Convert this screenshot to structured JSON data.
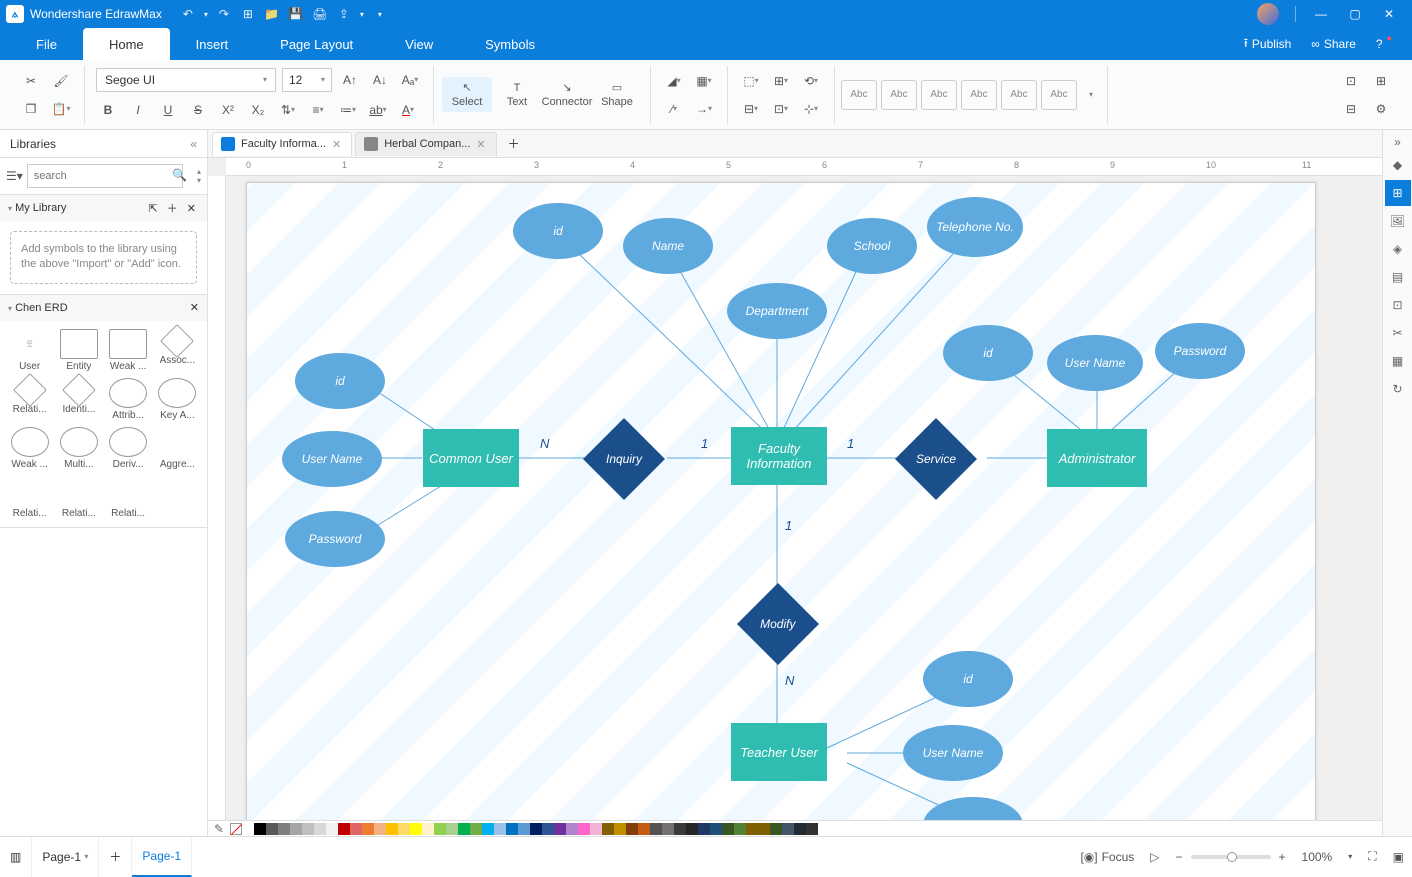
{
  "app": {
    "name": "Wondershare EdrawMax"
  },
  "qat": [
    "undo",
    "redo",
    "new",
    "open",
    "save",
    "print",
    "export",
    "more"
  ],
  "menu": {
    "items": [
      "File",
      "Home",
      "Insert",
      "Page Layout",
      "View",
      "Symbols"
    ],
    "active": 1,
    "publish": "Publish",
    "share": "Share"
  },
  "ribbon": {
    "font": {
      "name": "Segoe UI",
      "size": "12"
    },
    "tools": {
      "select": "Select",
      "text": "Text",
      "connector": "Connector",
      "shape": "Shape"
    },
    "styles": [
      "Abc",
      "Abc",
      "Abc",
      "Abc",
      "Abc",
      "Abc"
    ]
  },
  "leftpanel": {
    "title": "Libraries",
    "search_placeholder": "search",
    "mylib": {
      "title": "My Library",
      "hint": "Add symbols to the library using the above \"Import\" or \"Add\" icon."
    },
    "chen": {
      "title": "Chen ERD",
      "shapes": [
        "User",
        "Entity",
        "Weak ...",
        "Assoc...",
        "Relati...",
        "Identi...",
        "Attrib...",
        "Key A...",
        "Weak ...",
        "Multi...",
        "Deriv...",
        "Aggre...",
        "Relati...",
        "Relati...",
        "Relati..."
      ]
    }
  },
  "doctabs": [
    {
      "label": "Faculty Informa...",
      "active": true
    },
    {
      "label": "Herbal Compan...",
      "active": false
    }
  ],
  "ruler": [
    "0",
    "1",
    "2",
    "3",
    "4",
    "5",
    "6",
    "7",
    "8",
    "9",
    "10",
    "11"
  ],
  "diagram": {
    "entities": {
      "common_user": "Common User",
      "faculty_info": "Faculty Information",
      "administrator": "Administrator",
      "teacher_user": "Teacher User"
    },
    "attrs": {
      "cu_id": "id",
      "cu_username": "User Name",
      "cu_password": "Password",
      "fi_id": "id",
      "fi_name": "Name",
      "fi_dept": "Department",
      "fi_school": "School",
      "fi_tel": "Telephone No.",
      "ad_id": "id",
      "ad_username": "User Name",
      "ad_password": "Password",
      "tu_id": "id",
      "tu_username": "User Name"
    },
    "rels": {
      "inquiry": "Inquiry",
      "service": "Service",
      "modify": "Modify"
    },
    "card": {
      "nq_n": "N",
      "nq_1": "1",
      "sv_1l": "1",
      "sv_1r": "",
      "mod_1": "1",
      "mod_n": "N"
    }
  },
  "status": {
    "page_sheet": "Page-1",
    "page_tab": "Page-1",
    "focus": "Focus",
    "zoom": "100%"
  },
  "colorrow": [
    "#ffffff",
    "#000000",
    "#595959",
    "#7f7f7f",
    "#a5a5a5",
    "#bfbfbf",
    "#d8d8d8",
    "#f2f2f2",
    "#c00000",
    "#e06666",
    "#ed7d31",
    "#f4b183",
    "#ffc000",
    "#ffd966",
    "#ffff00",
    "#fff2cc",
    "#92d050",
    "#a9d08e",
    "#00b050",
    "#70ad47",
    "#00b0f0",
    "#9bc2e6",
    "#0070c0",
    "#5b9bd5",
    "#002060",
    "#305496",
    "#7030a0",
    "#b084cc",
    "#ff66cc",
    "#f4b0d7",
    "#806000",
    "#bf8f00",
    "#833c0c",
    "#c55a11",
    "#525252",
    "#757171",
    "#3a3a3a",
    "#262626",
    "#203764",
    "#1f4e78",
    "#375623",
    "#548235",
    "#806000",
    "#806000",
    "#385723",
    "#44546a",
    "#222a35",
    "#323232"
  ]
}
